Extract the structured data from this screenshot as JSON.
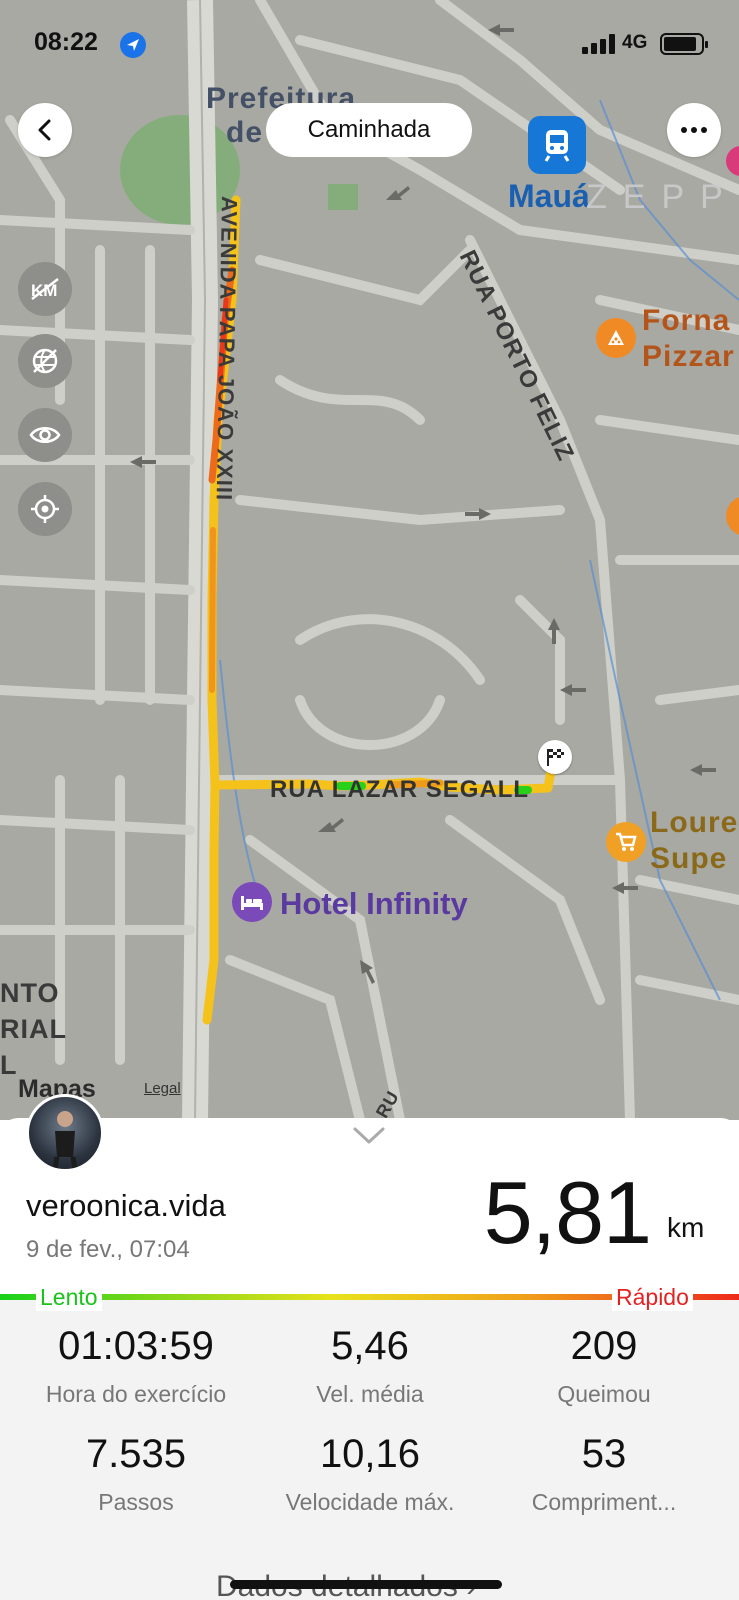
{
  "status_bar": {
    "time": "08:22",
    "network": "4G"
  },
  "header": {
    "activity_label": "Caminhada"
  },
  "map": {
    "labels": {
      "prefeitura": "Prefeitura",
      "prefeitura2": "de",
      "maua": "Mauá",
      "zepp": "ZEPP",
      "avenida": "AVENIDA PAPA JOÃO XXIII",
      "rua_porto": "RUA PORTO FELIZ",
      "forna": "Forna",
      "pizza": "Pizzar",
      "lazar": "RUA LAZAR SEGALL",
      "loure": "Loure",
      "supe": "Supe",
      "hotel": "Hotel Infinity",
      "nto": "NTO",
      "rial": "RIAL",
      "l": "L",
      "ru": "RU"
    },
    "attribution": "Mapas",
    "legal": "Legal"
  },
  "summary": {
    "username": "veroonica.vida",
    "date": "9 de fev., 07:04",
    "distance": "5,81",
    "distance_unit": "km"
  },
  "speed_legend": {
    "slow": "Lento",
    "fast": "Rápido"
  },
  "stats": [
    {
      "value": "01:03:59",
      "label": "Hora do exercício"
    },
    {
      "value": "5,46",
      "label": "Vel. média"
    },
    {
      "value": "209",
      "label": "Queimou"
    },
    {
      "value": "7.535",
      "label": "Passos"
    },
    {
      "value": "10,16",
      "label": "Velocidade máx."
    },
    {
      "value": "53",
      "label": "Compriment..."
    }
  ],
  "footer": {
    "details_label": "Dados detalhados"
  },
  "colors": {
    "route_slow": "#19d11a",
    "route_mid": "#f5c21a",
    "route_fast": "#ee2a1a",
    "accent_blue": "#1677d6",
    "poi_orange": "#f08a24",
    "hotel_purple": "#6b3fb0"
  }
}
